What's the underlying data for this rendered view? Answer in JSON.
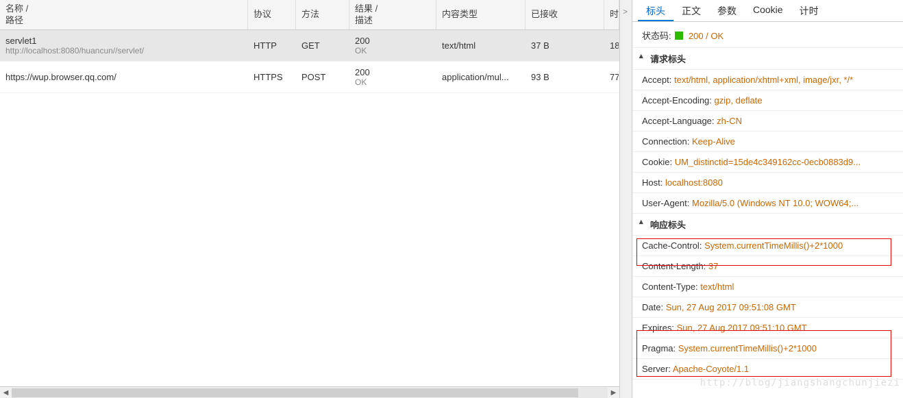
{
  "columns": {
    "name": "名称 /",
    "path": "路径",
    "protocol": "协议",
    "method": "方法",
    "result": "结果 /",
    "desc": "描述",
    "ctype": "内容类型",
    "received": "已接收",
    "time": "时"
  },
  "rows": [
    {
      "name": "servlet1",
      "path": "http://localhost:8080/huancun//servlet/",
      "protocol": "HTTP",
      "method": "GET",
      "result": "200",
      "desc": "OK",
      "ctype": "text/html",
      "received": "37 B",
      "time": "18"
    },
    {
      "name": "https://wup.browser.qq.com/",
      "path": "",
      "protocol": "HTTPS",
      "method": "POST",
      "result": "200",
      "desc": "OK",
      "ctype": "application/mul...",
      "received": "93 B",
      "time": "77"
    }
  ],
  "tabs": {
    "headers": "标头",
    "body": "正文",
    "params": "参数",
    "cookie": "Cookie",
    "timing": "计时"
  },
  "status": {
    "label": "状态码:",
    "value": "200 / OK"
  },
  "sections": {
    "req": "请求标头",
    "res": "响应标头"
  },
  "reqHeaders": [
    {
      "k": "Accept",
      "v": "text/html, application/xhtml+xml, image/jxr, */*"
    },
    {
      "k": "Accept-Encoding",
      "v": "gzip, deflate"
    },
    {
      "k": "Accept-Language",
      "v": "zh-CN"
    },
    {
      "k": "Connection",
      "v": "Keep-Alive"
    },
    {
      "k": "Cookie",
      "v": "UM_distinctid=15de4c349162cc-0ecb0883d9..."
    },
    {
      "k": "Host",
      "v": "localhost:8080"
    },
    {
      "k": "User-Agent",
      "v": "Mozilla/5.0 (Windows NT 10.0; WOW64;..."
    }
  ],
  "resHeaders": [
    {
      "k": "Cache-Control",
      "v": "System.currentTimeMillis()+2*1000"
    },
    {
      "k": "Content-Length",
      "v": "37"
    },
    {
      "k": "Content-Type",
      "v": "text/html"
    },
    {
      "k": "Date",
      "v": "Sun, 27 Aug 2017 09:51:08 GMT"
    },
    {
      "k": "Expires",
      "v": "Sun, 27 Aug 2017 09:51:10 GMT"
    },
    {
      "k": "Pragma",
      "v": "System.currentTimeMillis()+2*1000"
    },
    {
      "k": "Server",
      "v": "Apache-Coyote/1.1"
    }
  ],
  "watermark": "http://blog/jiangshangchunjiezi"
}
